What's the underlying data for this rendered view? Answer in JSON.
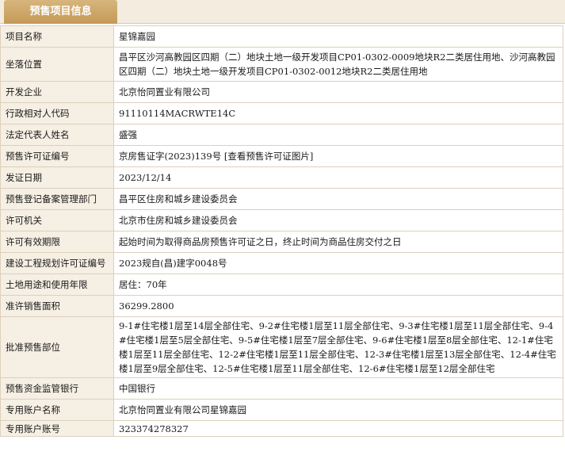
{
  "header": {
    "title": "预售项目信息"
  },
  "rows": [
    {
      "label": "项目名称",
      "value": "星锦嘉园"
    },
    {
      "label": "坐落位置",
      "value": "昌平区沙河高教园区四期（二）地块土地一级开发项目CP01-0302-0009地块R2二类居住用地、沙河高教园区四期（二）地块土地一级开发项目CP01-0302-0012地块R2二类居住用地"
    },
    {
      "label": "开发企业",
      "value": "北京怡同置业有限公司"
    },
    {
      "label": "行政相对人代码",
      "value": "91110114MACRWTE14C"
    },
    {
      "label": "法定代表人姓名",
      "value": "盛强"
    },
    {
      "label": "预售许可证编号",
      "value": "京房售证字(2023)139号",
      "link": "[查看预售许可证图片]"
    },
    {
      "label": "发证日期",
      "value": "2023/12/14"
    },
    {
      "label": "预售登记备案管理部门",
      "value": "昌平区住房和城乡建设委员会"
    },
    {
      "label": "许可机关",
      "value": "北京市住房和城乡建设委员会"
    },
    {
      "label": "许可有效期限",
      "value": "起始时间为取得商品房预售许可证之日，终止时间为商品住房交付之日"
    },
    {
      "label": "建设工程规划许可证编号",
      "value": "2023规自(昌)建字0048号"
    },
    {
      "label": "土地用途和使用年限",
      "value": "居住：70年"
    },
    {
      "label": "准许销售面积",
      "value": "36299.2800"
    },
    {
      "label": "批准预售部位",
      "value": "9-1#住宅楼1层至14层全部住宅、9-2#住宅楼1层至11层全部住宅、9-3#住宅楼1层至11层全部住宅、9-4#住宅楼1层至5层全部住宅、9-5#住宅楼1层至7层全部住宅、9-6#住宅楼1层至8层全部住宅、12-1#住宅楼1层至11层全部住宅、12-2#住宅楼1层至11层全部住宅、12-3#住宅楼1层至13层全部住宅、12-4#住宅楼1层至9层全部住宅、12-5#住宅楼1层至11层全部住宅、12-6#住宅楼1层至12层全部住宅"
    },
    {
      "label": "预售资金监管银行",
      "value": "中国银行"
    },
    {
      "label": "专用账户名称",
      "value": "北京怡同置业有限公司星锦嘉园"
    },
    {
      "label": "专用账户账号",
      "value": "323374278327"
    }
  ]
}
